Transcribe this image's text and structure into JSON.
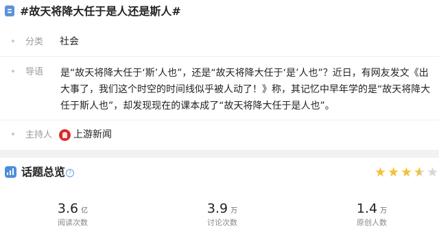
{
  "header": {
    "title": "#故天将降大任于是人还是斯人#"
  },
  "rows": {
    "category": {
      "label": "分类",
      "value": "社会"
    },
    "intro": {
      "label": "导语",
      "text": "是“故天将降大任于‘斯’人也”，还是“故天将降大任于‘是’人也”？近日，有网友发文《出大事了，我们这个时空的时间线似乎被人动了！》称，其记忆中早年学的是“故天将降大任于斯人也”，却发现现在的课本成了“故天将降大任于是人也”。"
    },
    "host": {
      "label": "主持人",
      "name": "上游新闻"
    }
  },
  "overview": {
    "title": "话题总览",
    "help_glyph": "?",
    "rating": 3.5,
    "rating_max": 5
  },
  "stats": [
    {
      "value": "3.6",
      "unit": "亿",
      "label": "阅读次数"
    },
    {
      "value": "3.9",
      "unit": "万",
      "label": "讨论次数"
    },
    {
      "value": "1.4",
      "unit": "万",
      "label": "原创人数"
    }
  ],
  "colors": {
    "accent_blue": "#5b93d8",
    "star_gold": "#f2c039",
    "host_logo_red": "#d62b2b"
  }
}
